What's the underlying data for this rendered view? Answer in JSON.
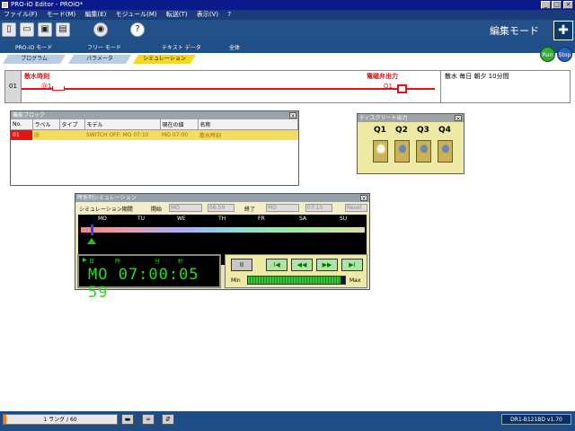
{
  "window": {
    "title": "PRO-iO Editor - PROiO*"
  },
  "menubar": [
    "ファイル(F)",
    "モード(M)",
    "編集(E)",
    "モジュール(M)",
    "転送(T)",
    "表示(V)",
    "?"
  ],
  "toolbar": {
    "help_label": "?",
    "mode_label": "編集モード"
  },
  "mode_row": [
    "PRO-iO モード",
    "フリー モード",
    "テキスト データ",
    "全体"
  ],
  "tabs": [
    "プログラム",
    "パラメータ",
    "シミュレーション"
  ],
  "run_label": "Run",
  "stop_label": "Stop",
  "ladder": {
    "rung_no": "01",
    "input_label": "散水時刻",
    "input_tag": "@1",
    "output_label": "電磁弁出力",
    "output_tag": "Q1",
    "comment": "散水 毎日 朝夕 10分間"
  },
  "function_block": {
    "title": "機能ブロック",
    "headers": [
      "No.",
      "ラベル",
      "タイプ",
      "モデル",
      "現在の値",
      "名称"
    ],
    "row": {
      "no": "01",
      "label": "@",
      "type": "",
      "model": "SWITCH OFF: MO 07:10",
      "current": "MO 07:00",
      "name": "散水時刻"
    }
  },
  "discrete_output": {
    "title": "ディスクリート出力",
    "labels": [
      "Q1",
      "Q2",
      "Q3",
      "Q4"
    ],
    "states": [
      true,
      false,
      false,
      false
    ]
  },
  "simulation": {
    "title": "時系列シミュレーション",
    "period_label": "シミュレーション期間",
    "start_label": "開始",
    "start_day": "MO",
    "start_time": "06:59",
    "end_label": "終了",
    "end_day": "MO",
    "end_time": "07:10",
    "reset_label": "Reset",
    "days": [
      "MO",
      "TU",
      "WE",
      "TH",
      "FR",
      "SA",
      "SU"
    ],
    "clock_labels": [
      "日",
      "時",
      "分",
      "秒"
    ],
    "clock": "MO 07:00:05 59",
    "buttons": [
      "II",
      "I◀",
      "◀◀",
      "▶▶",
      "▶I"
    ],
    "min_label": "Min",
    "max_label": "Max",
    "speed": 0.95
  },
  "status": {
    "rung": "1 ラング / 60",
    "progress": 0.02,
    "version": "DR1-B121BD v1.70"
  }
}
